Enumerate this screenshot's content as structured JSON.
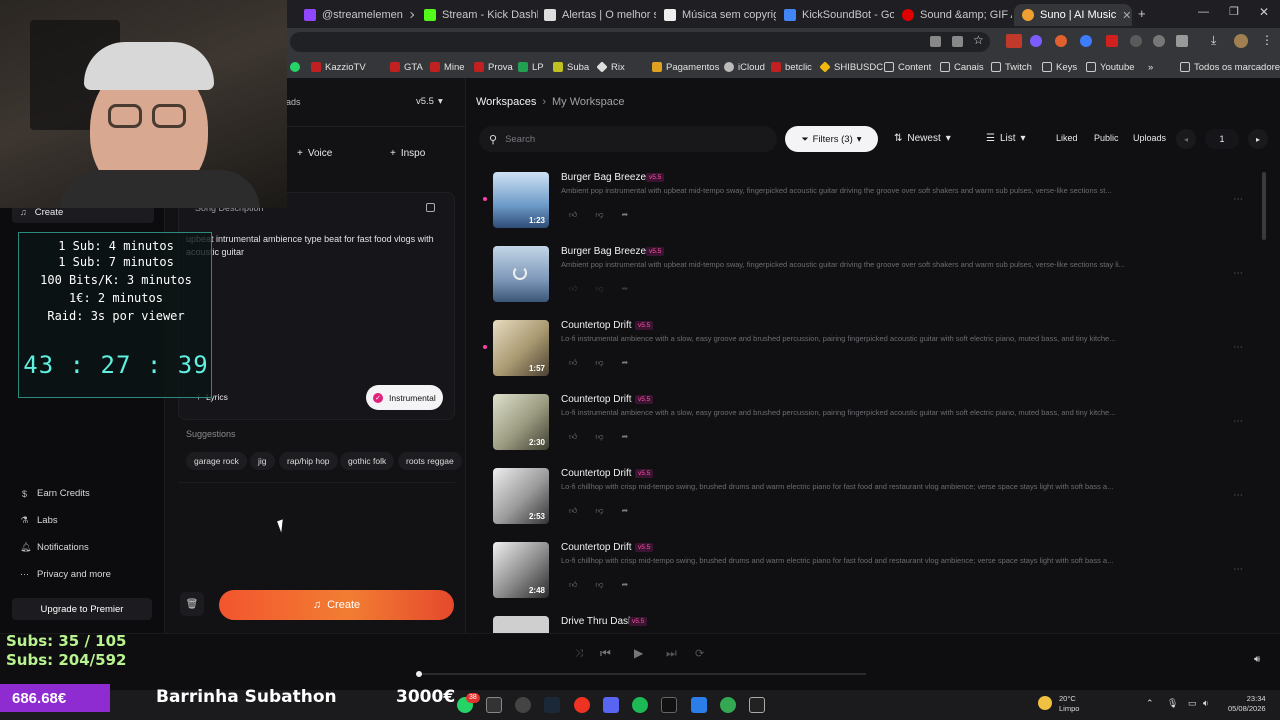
{
  "browser": {
    "tabs": [
      {
        "label": "@streamelemen",
        "color": "#9146ff"
      },
      {
        "label": "Stream - Kick Dashb",
        "color": "#53fc18"
      },
      {
        "label": "Alertas | O melhor s",
        "color": "#dddddd"
      },
      {
        "label": "Música sem copyrig",
        "color": "#eeeeee"
      },
      {
        "label": "KickSoundBot - Goo",
        "color": "#4285f4"
      },
      {
        "label": "Sound &amp; GIF Al",
        "color": "#e00000"
      },
      {
        "label": "Suno | AI Music",
        "color": "#f0a030"
      }
    ],
    "bookmarks": [
      "KazzioTV",
      "GTA",
      "Mine",
      "Prova",
      "LP",
      "Suba",
      "Rix",
      "Pagamentos",
      "iCloud",
      "betclic",
      "SHIBUSDC",
      "Content",
      "Canais",
      "Twitch",
      "Keys",
      "Youtube"
    ],
    "all_bookmarks": "Todos os marcadores"
  },
  "sidebar": {
    "create_label": "Create",
    "items": [
      {
        "label": "Earn Credits",
        "icon": "dollar-icon"
      },
      {
        "label": "Labs",
        "icon": "flask-icon"
      },
      {
        "label": "Notifications",
        "icon": "bell-icon"
      },
      {
        "label": "Privacy and more",
        "icon": "more-icon"
      }
    ],
    "upgrade_label": "Upgrade to Premier"
  },
  "create_panel": {
    "top_tab_partial": "ads",
    "version": "v5.5",
    "voice_label": "Voice",
    "inspo_label": "Inspo",
    "song_description_label": "Song Description",
    "song_description_value": "upbeat intrumental ambience type beat for fast food vlogs with acoustic guitar",
    "lyrics_label": "Lyrics",
    "instrumental_label": "Instrumental",
    "suggestions_label": "Suggestions",
    "suggestions": [
      "garage rock",
      "jig",
      "rap/hip hop",
      "gothic folk",
      "roots reggae"
    ],
    "create_button": "Create"
  },
  "main": {
    "breadcrumb_root": "Workspaces",
    "breadcrumb_current": "My Workspace",
    "search_placeholder": "Search",
    "filters_label": "Filters (3)",
    "sort_label": "Newest",
    "view_label": "List",
    "liked_label": "Liked",
    "public_label": "Public",
    "uploads_label": "Uploads",
    "page_number": "1",
    "songs": [
      {
        "title": "Burger Bag Breeze",
        "badge": "v5.5",
        "desc": "Ambient pop instrumental with upbeat mid-tempo sway, fingerpicked acoustic guitar driving the groove over soft shakers and warm sub pulses, verse-like sections st...",
        "duration": "1:23",
        "new": true
      },
      {
        "title": "Burger Bag Breeze",
        "badge": "v5.5",
        "desc": "Ambient pop instrumental with upbeat mid-tempo sway, fingerpicked acoustic guitar driving the groove over soft shakers and warm sub pulses, verse-like sections stay li...",
        "duration": "",
        "new": false
      },
      {
        "title": "Countertop Drift",
        "badge": "v5.5",
        "desc": "Lo-fi instrumental ambience with a slow, easy groove and brushed percussion, pairing fingerpicked acoustic guitar with soft electric piano, muted bass, and tiny kitche...",
        "duration": "1:57",
        "new": true
      },
      {
        "title": "Countertop Drift",
        "badge": "v5.5",
        "desc": "Lo-fi instrumental ambience with a slow, easy groove and brushed percussion, pairing fingerpicked acoustic guitar with soft electric piano, muted bass, and tiny kitche...",
        "duration": "2:30",
        "new": false
      },
      {
        "title": "Countertop Drift",
        "badge": "v5.5",
        "desc": "Lo-fi chillhop with crisp mid-tempo swing, brushed drums and warm electric piano for fast food and restaurant vlog ambience; verse space stays light with soft bass a...",
        "duration": "2:53",
        "new": false
      },
      {
        "title": "Countertop Drift",
        "badge": "v5.5",
        "desc": "Lo-fi chillhop with crisp mid-tempo swing, brushed drums and warm electric piano for fast food and restaurant vlog ambience; verse space stays light with soft bass a...",
        "duration": "2:48",
        "new": false
      },
      {
        "title": "Drive Thru Dash",
        "badge": "v5.5",
        "desc": "",
        "duration": "",
        "new": false
      }
    ]
  },
  "stream_overlay": {
    "timer_lines": [
      "1 Sub: 4 minutos",
      "1 Sub: 7 minutos",
      "100 Bits/K: 3 minutos",
      "1€: 2 minutos",
      "Raid: 3s por viewer"
    ],
    "countdown": "43 : 27 : 39",
    "subs_line1": "Subs: 35 / 105",
    "subs_line2": "Subs: 204/592",
    "money": "686.68€",
    "subathon_title": "Barrinha Subathon",
    "goal": "3000€"
  },
  "taskbar": {
    "weather_temp": "20°C",
    "weather_desc": "Limpo",
    "time": "23:34",
    "date": "05/08/2026",
    "badge_count": "38"
  }
}
